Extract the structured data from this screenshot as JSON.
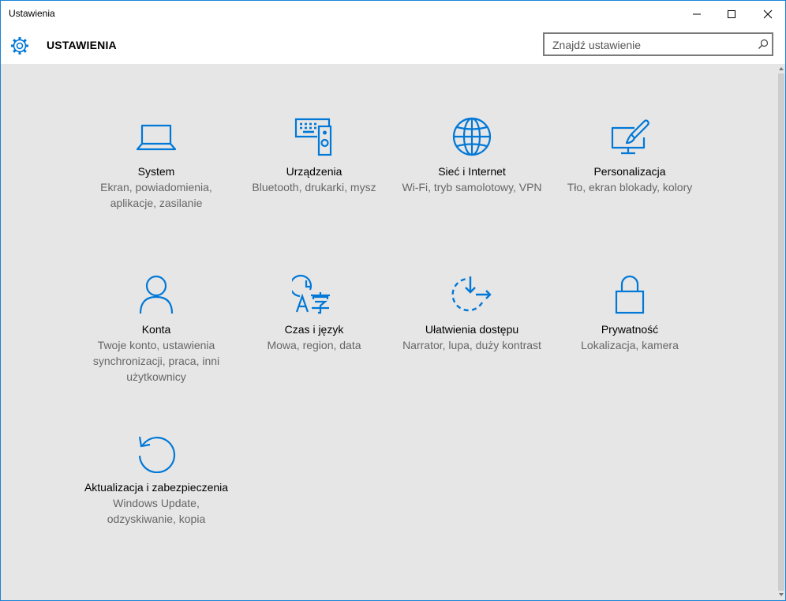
{
  "window": {
    "title": "Ustawienia"
  },
  "header": {
    "title": "USTAWIENIA",
    "search_placeholder": "Znajdź ustawienie"
  },
  "colors": {
    "accent": "#0078d7",
    "tile_title": "#000000",
    "tile_description": "#666666",
    "background": "#e6e6e6"
  },
  "tiles": [
    {
      "icon": "laptop-icon",
      "title": "System",
      "description": "Ekran, powiadomienia, aplikacje, zasilanie"
    },
    {
      "icon": "devices-icon",
      "title": "Urządzenia",
      "description": "Bluetooth, drukarki, mysz"
    },
    {
      "icon": "globe-icon",
      "title": "Sieć i Internet",
      "description": "Wi-Fi, tryb samolotowy, VPN"
    },
    {
      "icon": "personalization-icon",
      "title": "Personalizacja",
      "description": "Tło, ekran blokady, kolory"
    },
    {
      "icon": "person-icon",
      "title": "Konta",
      "description": "Twoje konto, ustawienia synchronizacji, praca, inni użytkownicy"
    },
    {
      "icon": "time-language-icon",
      "title": "Czas i język",
      "description": "Mowa, region, data"
    },
    {
      "icon": "ease-of-access-icon",
      "title": "Ułatwienia dostępu",
      "description": "Narrator, lupa, duży kontrast"
    },
    {
      "icon": "lock-icon",
      "title": "Prywatność",
      "description": "Lokalizacja, kamera"
    },
    {
      "icon": "update-icon",
      "title": "Aktualizacja i zabezpieczenia",
      "description": "Windows Update, odzyskiwanie, kopia"
    }
  ]
}
